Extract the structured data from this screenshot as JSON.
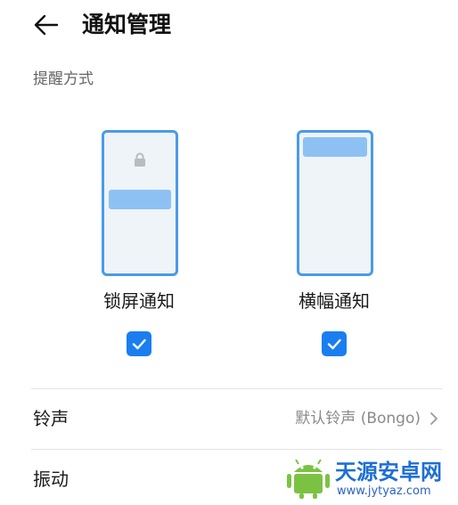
{
  "header": {
    "title": "通知管理"
  },
  "reminder": {
    "section_label": "提醒方式",
    "options": [
      {
        "label": "锁屏通知",
        "checked": true
      },
      {
        "label": "横幅通知",
        "checked": true
      }
    ]
  },
  "settings": [
    {
      "label": "铃声",
      "value": "默认铃声 (Bongo)"
    },
    {
      "label": "振动"
    }
  ],
  "watermark": {
    "title": "天源安卓网",
    "url": "www.jytyaz.com"
  },
  "colors": {
    "accent": "#1a7ef0",
    "phone_border": "#4a9be8",
    "phone_bar": "#8ec1f3"
  }
}
